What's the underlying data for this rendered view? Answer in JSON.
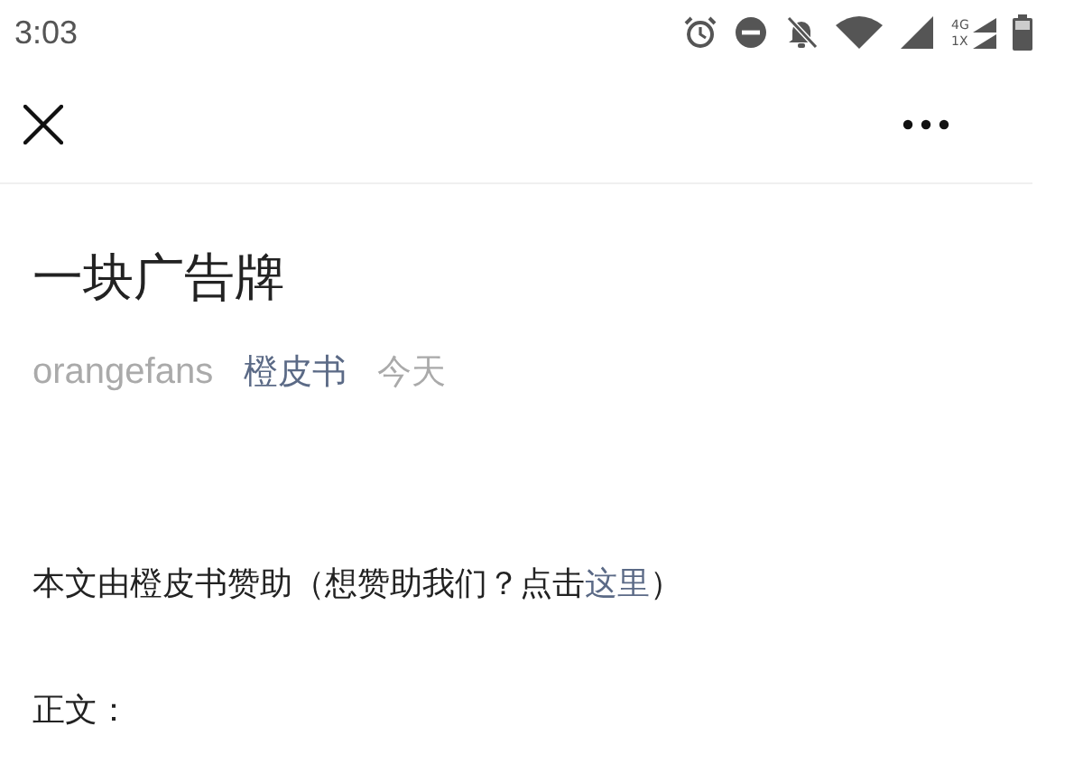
{
  "status_bar": {
    "time": "3:03",
    "network_labels": [
      "4G",
      "1X"
    ]
  },
  "article": {
    "title": "一块广告牌",
    "author": "orangefans",
    "source": "橙皮书",
    "date": "今天",
    "sponsor": {
      "before": "本文由橙皮书赞助（想赞助我们？点击",
      "link": "这里",
      "after": "）"
    },
    "body_label": "正文："
  }
}
